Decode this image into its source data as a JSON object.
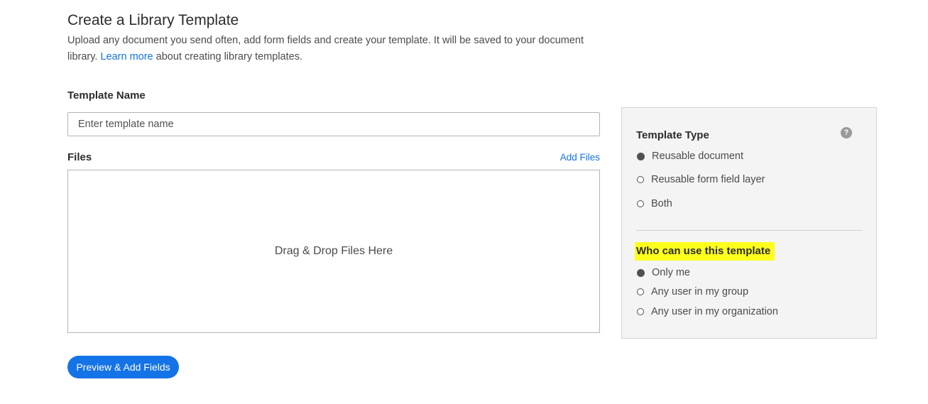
{
  "header": {
    "title": "Create a Library Template",
    "description_part1": "Upload any document you send often, add form fields and create your template. It will be saved to your document library.",
    "learn_more": "Learn more",
    "description_part2": "about creating library templates."
  },
  "template_name": {
    "label": "Template Name",
    "placeholder": "Enter template name",
    "value": ""
  },
  "files": {
    "label": "Files",
    "add_files": "Add Files",
    "dropzone_text": "Drag & Drop Files Here"
  },
  "actions": {
    "preview_label": "Preview & Add Fields"
  },
  "template_type": {
    "heading": "Template Type",
    "help_icon": "question-circle-icon",
    "options": [
      {
        "label": "Reusable document",
        "checked": true
      },
      {
        "label": "Reusable form field layer",
        "checked": false
      },
      {
        "label": "Both",
        "checked": false
      }
    ]
  },
  "who_can_use": {
    "heading": "Who can use this template",
    "highlight_color": "#ffff1e",
    "options": [
      {
        "label": "Only me",
        "checked": true
      },
      {
        "label": "Any user in my group",
        "checked": false
      },
      {
        "label": "Any user in my organization",
        "checked": false
      }
    ]
  },
  "colors": {
    "accent": "#1473e6",
    "panel_bg": "#f4f4f4"
  }
}
